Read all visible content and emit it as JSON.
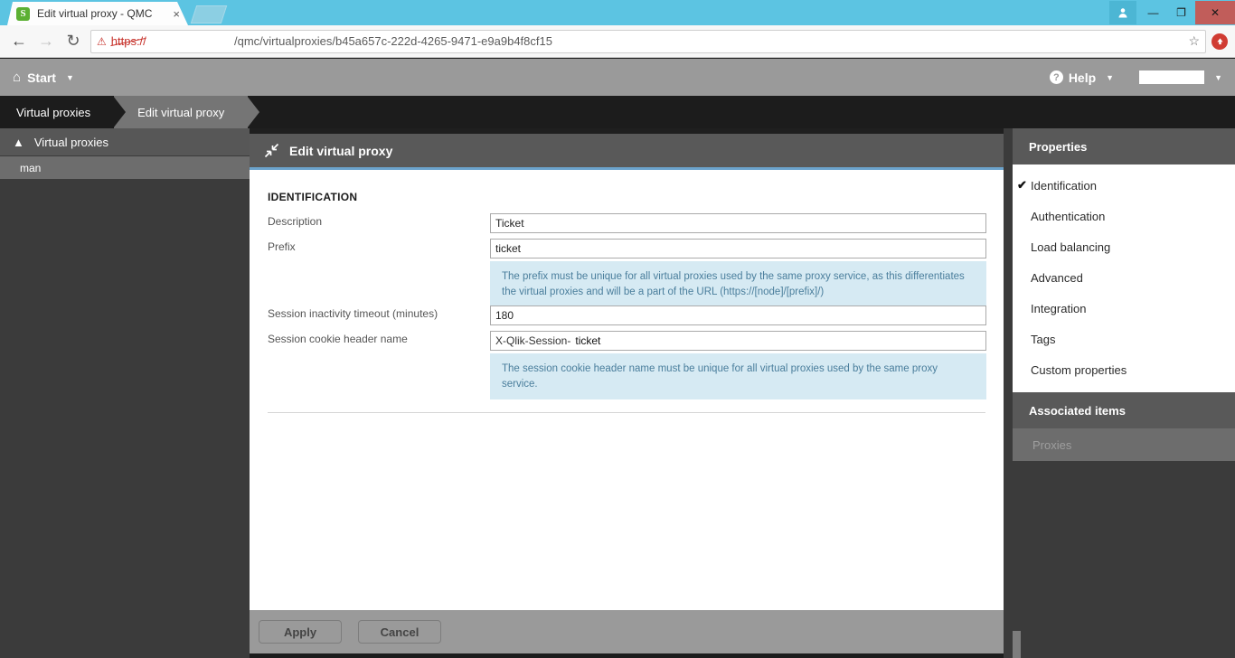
{
  "browser": {
    "tab_title": "Edit virtual proxy - QMC",
    "favicon_letter": "S",
    "close_tab_label": "×",
    "back_label": "←",
    "forward_label": "→",
    "reload_label": "↻",
    "warning_label": "⚠",
    "url_scheme": "https://",
    "url_path": "/qmc/virtualproxies/b45a657c-222d-4265-9471-e9a9b4f8cf15",
    "star_label": "☆",
    "update_label": "⬆",
    "avatar_label": "▴",
    "minimize_label": "—",
    "restore_label": "❐",
    "close_label": "✕"
  },
  "app_header": {
    "home_icon": "⌂",
    "start_label": "Start",
    "start_caret": "▼",
    "help_icon": "?",
    "help_label": "Help",
    "help_caret": "▼",
    "user_caret": "▼"
  },
  "breadcrumb": {
    "items": [
      {
        "label": "Virtual proxies"
      },
      {
        "label": "Edit virtual proxy"
      }
    ]
  },
  "sidebar": {
    "chevron": "▲",
    "header_label": "Virtual proxies",
    "items": [
      {
        "label": "man"
      }
    ]
  },
  "content": {
    "title": "Edit virtual proxy",
    "section_title": "IDENTIFICATION",
    "fields": [
      {
        "label": "Description",
        "value": "Ticket"
      },
      {
        "label": "Prefix",
        "value": "ticket"
      },
      {
        "label": "Session inactivity timeout (minutes)",
        "value": "180"
      },
      {
        "label": "Session cookie header name",
        "prefix": "X-Qlik-Session-",
        "value": "ticket"
      }
    ],
    "info_prefix": "The prefix must be unique for all virtual proxies used by the same proxy service, as this differentiates the virtual proxies and will be a part of the URL (https://[node]/[prefix]/)",
    "info_cookie": "The session cookie header name must be unique for all virtual proxies used by the same proxy service."
  },
  "footer": {
    "apply_label": "Apply",
    "cancel_label": "Cancel"
  },
  "right_panel": {
    "properties_title": "Properties",
    "check_mark": "✔",
    "properties": [
      {
        "label": "Identification",
        "selected": true
      },
      {
        "label": "Authentication",
        "selected": false
      },
      {
        "label": "Load balancing",
        "selected": false
      },
      {
        "label": "Advanced",
        "selected": false
      },
      {
        "label": "Integration",
        "selected": false
      },
      {
        "label": "Tags",
        "selected": false
      },
      {
        "label": "Custom properties",
        "selected": false
      }
    ],
    "associated_title": "Associated items",
    "associated": [
      {
        "label": "Proxies"
      }
    ]
  },
  "colors": {
    "accent_blue": "#6ba3cc",
    "chrome_blue": "#5cc4e2",
    "info_bg": "#d6eaf3",
    "info_text": "#4a7e9c",
    "close_red": "#c15d5a"
  }
}
